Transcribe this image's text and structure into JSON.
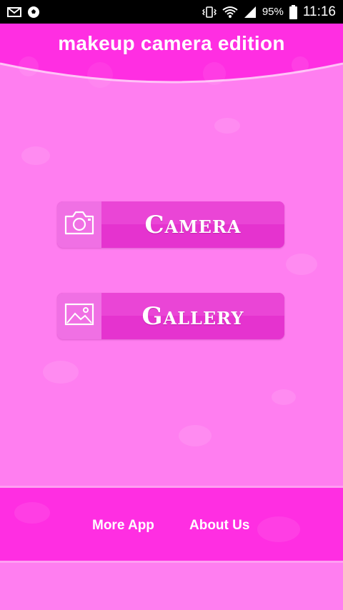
{
  "status_bar": {
    "battery_percent": "95%",
    "time": "11:16",
    "left_icons": [
      "mail-icon",
      "soccer-ball-icon"
    ],
    "right_icons": [
      "vibrate-icon",
      "wifi-icon",
      "signal-icon",
      "battery-icon"
    ]
  },
  "header": {
    "title": "makeup camera edition"
  },
  "buttons": {
    "camera": {
      "label": "Camera",
      "icon": "camera-icon"
    },
    "gallery": {
      "label": "Gallery",
      "icon": "image-icon"
    }
  },
  "footer": {
    "more_app": "More App",
    "about_us": "About Us"
  },
  "colors": {
    "background": "#ff7ef0",
    "header": "#ff2ee2",
    "button": "#e533cf",
    "footer": "#ff2ee2",
    "text": "#ffffff"
  }
}
